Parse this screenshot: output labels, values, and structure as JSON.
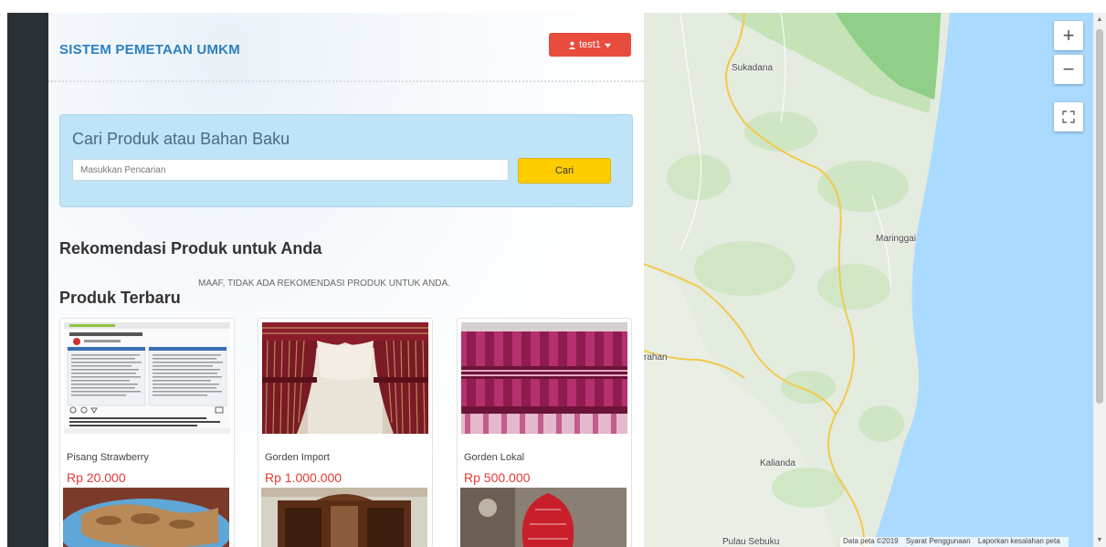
{
  "header": {
    "brand": "SISTEM PEMETAAN UMKM",
    "user": "test1"
  },
  "search": {
    "title": "Cari Produk atau Bahan Baku",
    "placeholder": "Masukkan Pencarian",
    "button": "Cari"
  },
  "sections": {
    "recommend_title": "Rekomendasi Produk untuk Anda",
    "recommend_empty": "MAAF, TIDAK ADA REKOMENDASI PRODUK UNTUK ANDA.",
    "latest_title": "Produk Terbaru"
  },
  "products": [
    {
      "name": "Pisang Strawberry",
      "price": "Rp 20.000"
    },
    {
      "name": "Gorden Import",
      "price": "Rp 1.000.000"
    },
    {
      "name": "Gorden Lokal",
      "price": "Rp 500.000"
    }
  ],
  "map": {
    "labels": [
      "Sukadana",
      "Maringgai",
      "rahan",
      "Kalianda",
      "Pulau Sebuku"
    ],
    "zoom_in": "+",
    "zoom_out": "−",
    "attribution": [
      "Data peta ©2019",
      "Syarat Penggunaan",
      "Laporkan kesalahan peta"
    ]
  },
  "colors": {
    "brand_blue": "#2a7fc4",
    "user_red": "#e84c3d",
    "search_yellow": "#ffcc00",
    "price_red": "#e53935",
    "water": "#aadaff",
    "land": "#e3eadf"
  },
  "icons": {
    "user": "user-icon",
    "caret": "caret-down-icon",
    "fullscreen": "fullscreen-icon"
  }
}
